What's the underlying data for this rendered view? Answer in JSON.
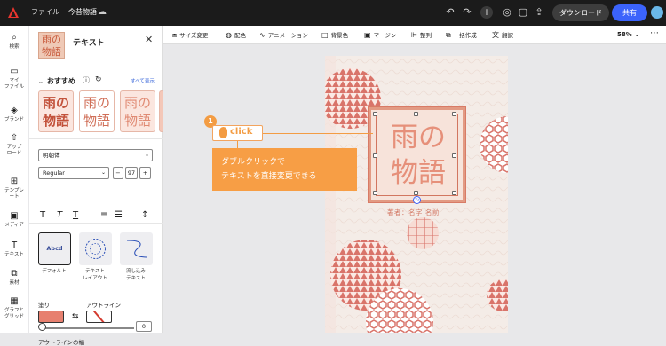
{
  "topbar": {
    "file_label": "ファイル",
    "doc_title": "今昔物語",
    "download_label": "ダウンロード",
    "share_label": "共有"
  },
  "rail": {
    "items": [
      {
        "label": "検索"
      },
      {
        "label": "マイ\nファイル"
      },
      {
        "label": "ブランド"
      },
      {
        "label": "アップ\nロード"
      },
      {
        "label": "テンプレ\nート"
      },
      {
        "label": "メディア"
      },
      {
        "label": "テキスト"
      },
      {
        "label": "素材"
      },
      {
        "label": "グラフと\nグリッド"
      }
    ]
  },
  "panel": {
    "thumb_text": "雨の物語",
    "title": "テキスト",
    "recommended_label": "おすすめ",
    "see_all": "すべて表示",
    "style_cards": [
      "雨の物語",
      "雨の物語",
      "雨の物語"
    ],
    "font_family": "明朝体",
    "font_weight": "Regular",
    "font_size": "97",
    "layout_cards": [
      {
        "thumb": "Abcd",
        "label": "デフォルト"
      },
      {
        "thumb": "ABCDEFGH",
        "label": "テキスト\nレイアウト"
      },
      {
        "thumb": "Abc defg",
        "label": "流し込み\nテキスト"
      }
    ],
    "fill_label": "塗り",
    "outline_label": "アウトライン",
    "outline_width_label": "アウトラインの幅",
    "outline_width_value": "0"
  },
  "toolbar": {
    "items": [
      {
        "icon": "resize-icon",
        "label": "サイズ変更"
      },
      {
        "icon": "palette-icon",
        "label": "配色"
      },
      {
        "icon": "animation-icon",
        "label": "アニメーション"
      },
      {
        "icon": "background-icon",
        "label": "背景色"
      },
      {
        "icon": "margin-icon",
        "label": "マージン"
      },
      {
        "icon": "align-icon",
        "label": "整列"
      },
      {
        "icon": "batch-icon",
        "label": "一括作成"
      },
      {
        "icon": "translate-icon",
        "label": "翻訳"
      }
    ],
    "zoom": "58%"
  },
  "canvas": {
    "title_text": "雨の物語",
    "author_text": "著者：名字 名前"
  },
  "callout": {
    "number": "1",
    "click_text": "click",
    "note_line1": "ダブルクリックで",
    "note_line2": "テキストを直接変更できる"
  },
  "colors": {
    "accent": "#3b63fb",
    "callout": "#f79e45",
    "poster_pink": "#d9746a",
    "fill_swatch": "#e7806f"
  }
}
